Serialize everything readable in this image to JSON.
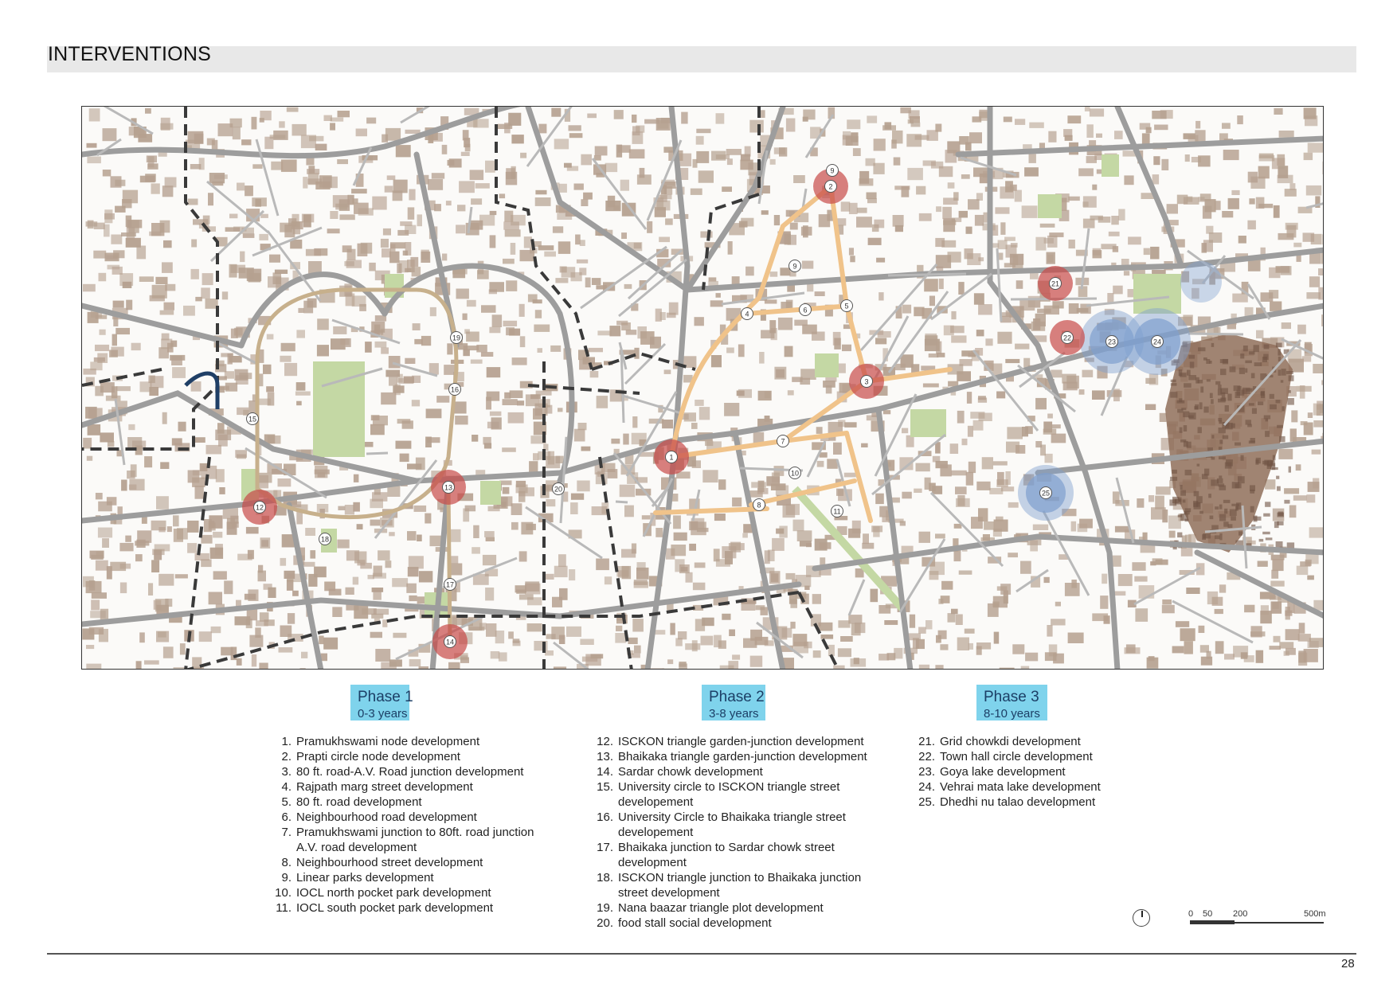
{
  "page": {
    "title": "INTERVENTIONS",
    "page_number": "28"
  },
  "map": {
    "markers": [
      {
        "id": "1",
        "kind": "node"
      },
      {
        "id": "2",
        "kind": "node"
      },
      {
        "id": "3",
        "kind": "node"
      },
      {
        "id": "4",
        "kind": "street"
      },
      {
        "id": "5",
        "kind": "street"
      },
      {
        "id": "6",
        "kind": "street"
      },
      {
        "id": "7",
        "kind": "street"
      },
      {
        "id": "8",
        "kind": "street"
      },
      {
        "id": "9",
        "kind": "park"
      },
      {
        "id": "10",
        "kind": "park"
      },
      {
        "id": "11",
        "kind": "park"
      },
      {
        "id": "12",
        "kind": "node"
      },
      {
        "id": "13",
        "kind": "node"
      },
      {
        "id": "14",
        "kind": "node"
      },
      {
        "id": "15",
        "kind": "street"
      },
      {
        "id": "16",
        "kind": "street"
      },
      {
        "id": "17",
        "kind": "street"
      },
      {
        "id": "18",
        "kind": "street"
      },
      {
        "id": "19",
        "kind": "plot"
      },
      {
        "id": "20",
        "kind": "plot"
      },
      {
        "id": "21",
        "kind": "node"
      },
      {
        "id": "22",
        "kind": "node"
      },
      {
        "id": "23",
        "kind": "lake"
      },
      {
        "id": "24",
        "kind": "lake"
      },
      {
        "id": "25",
        "kind": "lake"
      }
    ],
    "colors": {
      "building": "#b5a08f",
      "road": "#9d9d9d",
      "boundary": "#3a3a3a",
      "park": "#c4d8a4",
      "node": "#c84a48",
      "street_phase1": "#c7b08c",
      "street_phase2": "#f0c38a",
      "lake": "#7f9fcf",
      "old_city": "#8f6f5a"
    },
    "scale": {
      "labels": [
        "0",
        "50",
        "200",
        "500m"
      ]
    }
  },
  "phases": [
    {
      "name": "Phase 1",
      "years": "0-3 years",
      "items": [
        {
          "n": "1.",
          "text": "Pramukhswami node development"
        },
        {
          "n": "2.",
          "text": "Prapti circle node development"
        },
        {
          "n": "3.",
          "text": "80 ft. road-A.V. Road junction development"
        },
        {
          "n": "4.",
          "text": "Rajpath marg street development"
        },
        {
          "n": "5.",
          "text": "80 ft. road development"
        },
        {
          "n": "6.",
          "text": "Neighbourhood road development"
        },
        {
          "n": "7.",
          "text": "Pramukhswami junction to 80ft. road junction"
        },
        {
          "n": "",
          "text": "A.V. road development"
        },
        {
          "n": "8.",
          "text": "Neighbourhood street development"
        },
        {
          "n": "9.",
          "text": "Linear parks development"
        },
        {
          "n": "10.",
          "text": "IOCL north pocket park development"
        },
        {
          "n": "11.",
          "text": "IOCL south pocket park development"
        }
      ]
    },
    {
      "name": "Phase 2",
      "years": "3-8 years",
      "items": [
        {
          "n": "12.",
          "text": "ISCKON triangle garden-junction development"
        },
        {
          "n": "13.",
          "text": "Bhaikaka triangle garden-junction development"
        },
        {
          "n": "14.",
          "text": "Sardar chowk development"
        },
        {
          "n": "15.",
          "text": "University circle to ISCKON triangle street"
        },
        {
          "n": "",
          "text": "developement"
        },
        {
          "n": "16.",
          "text": "University Circle to Bhaikaka triangle street"
        },
        {
          "n": "",
          "text": "developement"
        },
        {
          "n": "17.",
          "text": "Bhaikaka junction to Sardar chowk street"
        },
        {
          "n": "",
          "text": "development"
        },
        {
          "n": "18.",
          "text": "ISCKON triangle junction to Bhaikaka junction"
        },
        {
          "n": "",
          "text": "street development"
        },
        {
          "n": "19.",
          "text": "Nana baazar triangle plot development"
        },
        {
          "n": "20.",
          "text": "food stall social development"
        }
      ]
    },
    {
      "name": "Phase 3",
      "years": "8-10 years",
      "items": [
        {
          "n": "21.",
          "text": "Grid chowkdi development"
        },
        {
          "n": "22.",
          "text": "Town hall circle development"
        },
        {
          "n": "23.",
          "text": "Goya lake development"
        },
        {
          "n": "24.",
          "text": "Vehrai mata lake development"
        },
        {
          "n": "25.",
          "text": "Dhedhi nu talao development"
        }
      ]
    }
  ]
}
